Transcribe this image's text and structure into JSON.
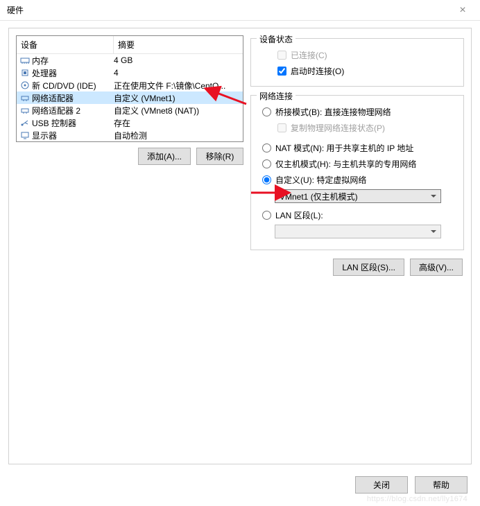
{
  "window": {
    "title": "硬件"
  },
  "device_table": {
    "header_device": "设备",
    "header_summary": "摘要",
    "rows": [
      {
        "icon": "memory-icon",
        "name": "内存",
        "summary": "4 GB",
        "selected": false
      },
      {
        "icon": "cpu-icon",
        "name": "处理器",
        "summary": "4",
        "selected": false
      },
      {
        "icon": "disc-icon",
        "name": "新 CD/DVD (IDE)",
        "summary": "正在使用文件 F:\\镜像\\CentO...",
        "selected": false
      },
      {
        "icon": "network-icon",
        "name": "网络适配器",
        "summary": "自定义 (VMnet1)",
        "selected": true
      },
      {
        "icon": "network-icon",
        "name": "网络适配器 2",
        "summary": "自定义 (VMnet8 (NAT))",
        "selected": false
      },
      {
        "icon": "usb-icon",
        "name": "USB 控制器",
        "summary": "存在",
        "selected": false
      },
      {
        "icon": "display-icon",
        "name": "显示器",
        "summary": "自动检测",
        "selected": false
      }
    ]
  },
  "buttons": {
    "add": "添加(A)...",
    "remove": "移除(R)",
    "lan_segments": "LAN 区段(S)...",
    "advanced": "高级(V)...",
    "close": "关闭",
    "help": "帮助"
  },
  "device_status": {
    "legend": "设备状态",
    "connected": "已连接(C)",
    "connect_at_poweron": "启动时连接(O)",
    "connected_checked": false,
    "connect_at_poweron_checked": true
  },
  "network_connection": {
    "legend": "网络连接",
    "bridged": "桥接模式(B): 直接连接物理网络",
    "replicate": "复制物理网络连接状态(P)",
    "nat": "NAT 模式(N): 用于共享主机的 IP 地址",
    "hostonly": "仅主机模式(H): 与主机共享的专用网络",
    "custom": "自定义(U): 特定虚拟网络",
    "custom_value": "VMnet1 (仅主机模式)",
    "lan_segment": "LAN 区段(L):",
    "lan_segment_value": "",
    "selected": "custom"
  },
  "watermark": "https://blog.csdn.net/lly1674"
}
